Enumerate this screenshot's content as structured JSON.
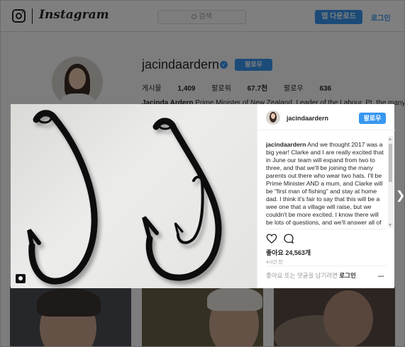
{
  "topbar": {
    "wordmark": "Instagram",
    "search_placeholder": "검색",
    "app_download_label": "앱 다운로드",
    "login_label": "로그인"
  },
  "profile": {
    "username": "jacindaardern",
    "verified_mark": "✓",
    "follow_label": "팔로우",
    "stats": [
      {
        "label": "게시물",
        "value": "1,409"
      },
      {
        "label": "팔로워",
        "value": "67.7천"
      },
      {
        "label": "팔로우",
        "value": "636"
      }
    ],
    "bio_name": "Jacinda Ardern",
    "bio_text": "Prime Minister of New Zealand. Leader of the Labour. Pt. the many the ver..."
  },
  "post": {
    "author": "jacindaardern",
    "follow_label": "팔로우",
    "caption_author": "jacindaardern",
    "caption_text": "And we thought 2017 was a big year! Clarke and I are really excited that in June our team will expand from two to three, and that we'll be joining the many parents out there who wear two hats. I'll be Prime Minister AND a mum, and Clarke will be \"first man of fishing\" and stay at home dad. I think it's fair to say that this will be a wee one that a village will raise, but we couldn't be more excited. I know there will be lots of questions, and we'll answer all of them (I can assure you we have a plan all",
    "likes_text": "좋아요 24,563개",
    "time_ago": "4시간 전",
    "comment_prompt": "좋아요 또는 댓글을 남기려면",
    "comment_login": "로그인",
    "comment_suffix": ".",
    "more_icon_glyph": "...",
    "icons": {
      "like": "heart-icon",
      "comment": "comment-icon",
      "tag": "user-tag-icon",
      "next": "chevron-right-icon"
    }
  },
  "colors": {
    "accent": "#3897f0",
    "text": "#262626",
    "muted": "#999999"
  }
}
